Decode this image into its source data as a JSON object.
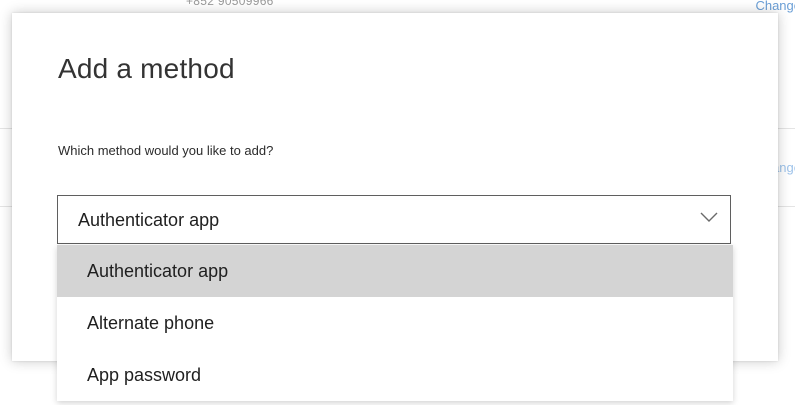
{
  "background": {
    "phone_number": "+852 90509966",
    "change_link_label": "Change",
    "change_link_2_label": "Change"
  },
  "dialog": {
    "title": "Add a method",
    "question": "Which method would you like to add?",
    "select": {
      "value": "Authenticator app",
      "options": [
        {
          "label": "Authenticator app",
          "selected": true
        },
        {
          "label": "Alternate phone",
          "selected": false
        },
        {
          "label": "App password",
          "selected": false
        }
      ]
    }
  },
  "colors": {
    "link": "#6b9fd6",
    "selected_option_bg": "#d4d4d4",
    "select_border": "#5f5f5f"
  },
  "icons": {
    "select_arrow": "chevron-down-icon"
  }
}
